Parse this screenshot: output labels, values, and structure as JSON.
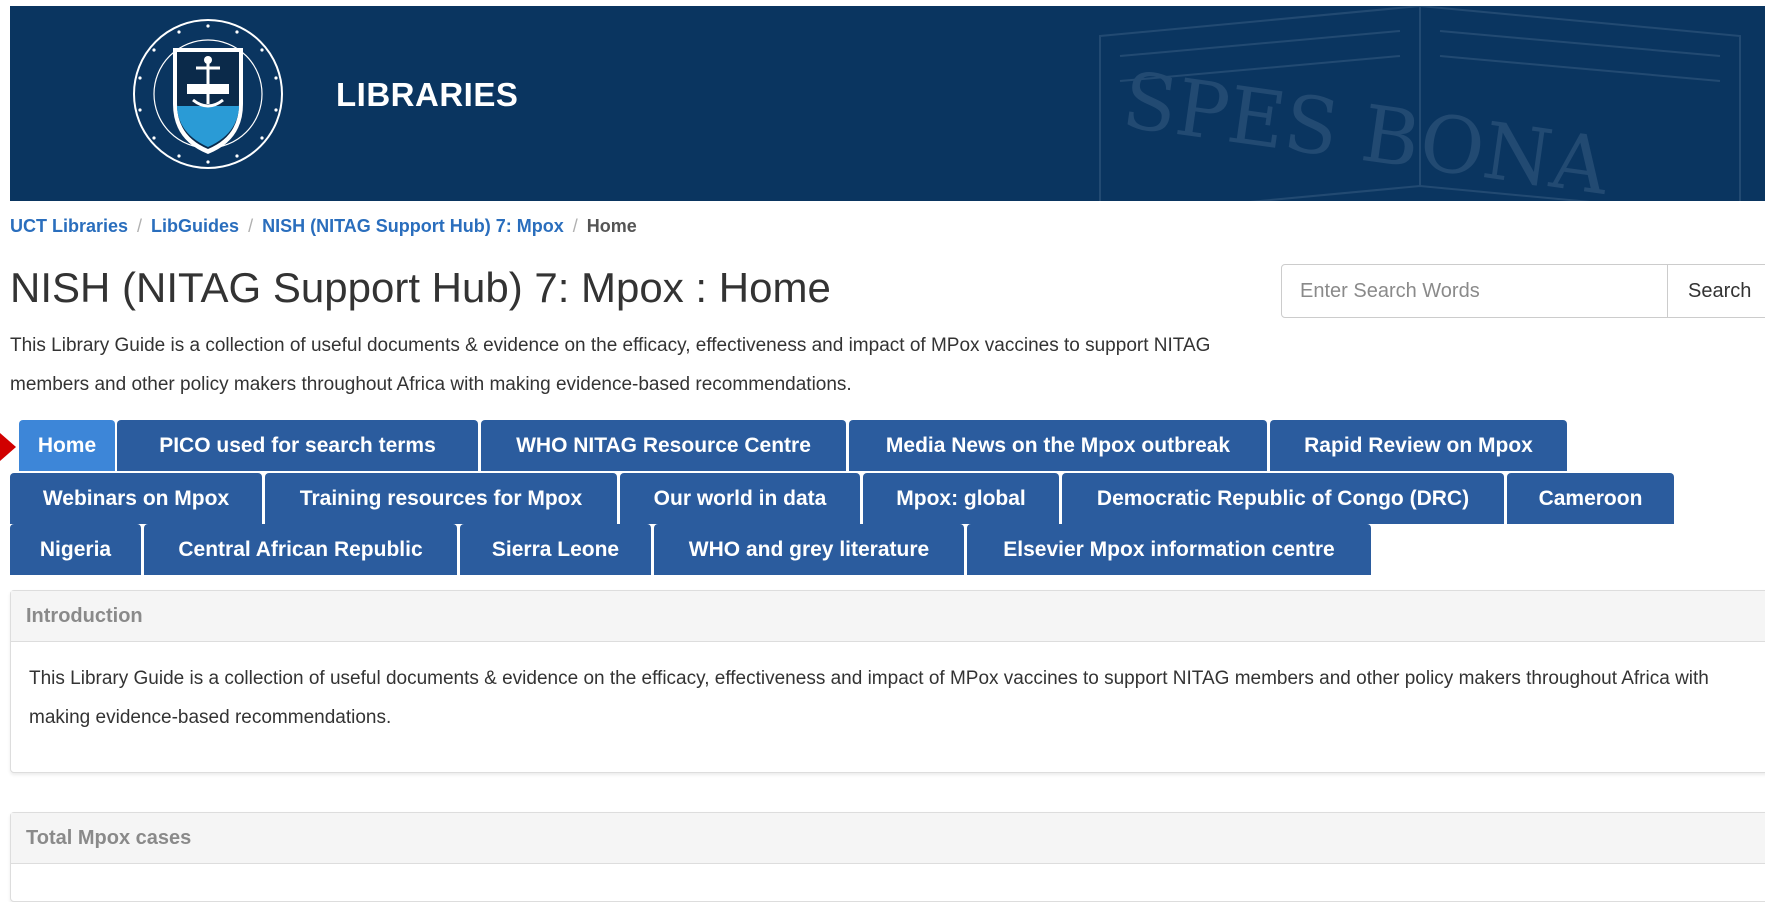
{
  "header": {
    "brand": "LIBRARIES",
    "watermark_text": "SPES BONA"
  },
  "breadcrumb": {
    "items": [
      "UCT Libraries",
      "LibGuides",
      "NISH (NITAG Support Hub) 7: Mpox"
    ],
    "current": "Home"
  },
  "page": {
    "title": "NISH (NITAG Support Hub) 7: Mpox : Home",
    "description": "This Library Guide is a collection of useful documents & evidence on the efficacy, effectiveness and impact of MPox vaccines to support NITAG members and other policy makers throughout Africa with making evidence-based recommendations."
  },
  "search": {
    "placeholder": "Enter Search Words",
    "button_label": "Search"
  },
  "tabs": [
    {
      "label": "Home",
      "active": true
    },
    {
      "label": "PICO used for search terms"
    },
    {
      "label": "WHO NITAG Resource Centre"
    },
    {
      "label": "Media News on the Mpox outbreak"
    },
    {
      "label": "Rapid Review on Mpox"
    },
    {
      "label": "Webinars on Mpox"
    },
    {
      "label": "Training resources for Mpox"
    },
    {
      "label": "Our world in data"
    },
    {
      "label": "Mpox: global"
    },
    {
      "label": "Democratic Republic of Congo (DRC)"
    },
    {
      "label": "Cameroon"
    },
    {
      "label": "Nigeria"
    },
    {
      "label": "Central African Republic"
    },
    {
      "label": "Sierra Leone"
    },
    {
      "label": "WHO and grey literature"
    },
    {
      "label": "Elsevier Mpox information centre"
    }
  ],
  "panels": {
    "introduction": {
      "title": "Introduction",
      "body": "This Library Guide is a collection of useful documents & evidence on the efficacy, effectiveness and impact of MPox vaccines to support NITAG members and other policy makers throughout Africa with making evidence-based recommendations."
    },
    "total_cases": {
      "title": "Total Mpox cases"
    }
  },
  "colors": {
    "banner": "#0a3560",
    "tab": "#2b5c9e",
    "tab_active": "#3d86d8",
    "link": "#2a6ebd",
    "indicator_arrow": "#d10000"
  }
}
